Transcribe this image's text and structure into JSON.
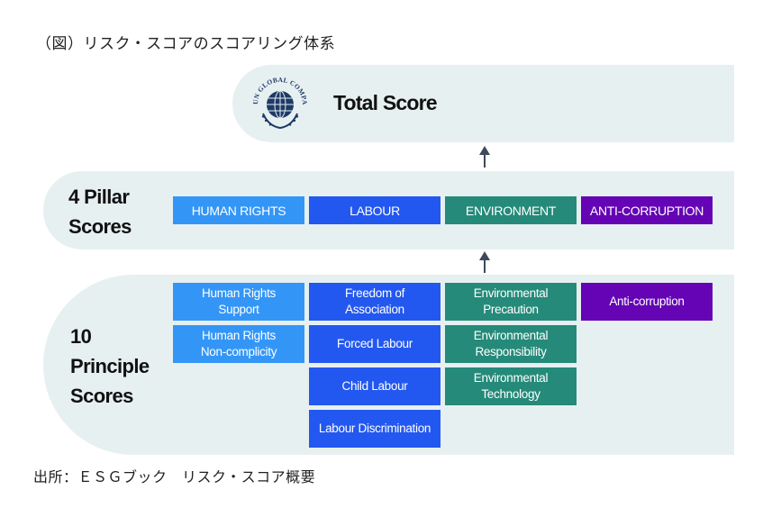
{
  "caption": "（図）リスク・スコアのスコアリング体系",
  "source": "出所：ＥＳＧブック　リスク・スコア概要",
  "total": {
    "title": "Total Score",
    "logo_text": "UN GLOBAL COMPACT",
    "logo_icon": "un-global-compact-logo"
  },
  "pillar": {
    "label_line1": "4 Pillar",
    "label_line2": "Scores",
    "items": [
      {
        "label": "HUMAN RIGHTS",
        "color": "#3396f7"
      },
      {
        "label": "LABOUR",
        "color": "#2358f0"
      },
      {
        "label": "ENVIRONMENT",
        "color": "#258a79"
      },
      {
        "label": "ANTI-CORRUPTION",
        "color": "#6404b4"
      }
    ]
  },
  "principle": {
    "label_line1": "10",
    "label_line2": "Principle",
    "label_line3": "Scores",
    "columns": [
      {
        "pillar": "HUMAN RIGHTS",
        "color": "#3396f7",
        "items": [
          {
            "line1": "Human Rights",
            "line2": "Support"
          },
          {
            "line1": "Human Rights",
            "line2": "Non-complicity"
          }
        ]
      },
      {
        "pillar": "LABOUR",
        "color": "#2358f0",
        "items": [
          {
            "line1": "Freedom of",
            "line2": "Association"
          },
          {
            "line1": "Forced Labour",
            "line2": ""
          },
          {
            "line1": "Child Labour",
            "line2": ""
          },
          {
            "line1": "Labour Discrimination",
            "line2": ""
          }
        ]
      },
      {
        "pillar": "ENVIRONMENT",
        "color": "#258a79",
        "items": [
          {
            "line1": "Environmental",
            "line2": "Precaution"
          },
          {
            "line1": "Environmental",
            "line2": "Responsibility"
          },
          {
            "line1": "Environmental",
            "line2": "Technology"
          }
        ]
      },
      {
        "pillar": "ANTI-CORRUPTION",
        "color": "#6404b4",
        "items": [
          {
            "line1": "Anti-corruption",
            "line2": ""
          }
        ]
      }
    ]
  },
  "colors": {
    "panel_bg": "#e7f0f1",
    "arrow": "#3e4a5a"
  }
}
